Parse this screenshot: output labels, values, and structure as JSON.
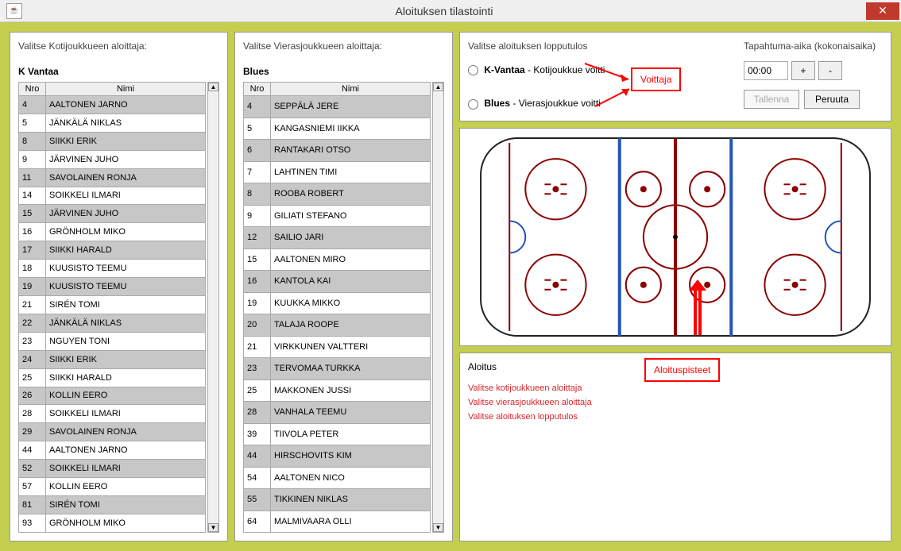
{
  "window": {
    "title": "Aloituksen tilastointi"
  },
  "home": {
    "label": "Valitse Kotijoukkueen aloittaja:",
    "team": "K Vantaa",
    "headers": {
      "nro": "Nro",
      "nimi": "Nimi"
    },
    "players": [
      {
        "nro": "4",
        "nimi": "AALTONEN JARNO"
      },
      {
        "nro": "5",
        "nimi": "JÄNKÄLÄ NIKLAS"
      },
      {
        "nro": "8",
        "nimi": "SIIKKI ERIK"
      },
      {
        "nro": "9",
        "nimi": "JÄRVINEN JUHO"
      },
      {
        "nro": "11",
        "nimi": "SAVOLAINEN RONJA"
      },
      {
        "nro": "14",
        "nimi": "SOIKKELI ILMARI"
      },
      {
        "nro": "15",
        "nimi": "JÄRVINEN JUHO"
      },
      {
        "nro": "16",
        "nimi": "GRÖNHOLM MIKO"
      },
      {
        "nro": "17",
        "nimi": "SIIKKI HARALD"
      },
      {
        "nro": "18",
        "nimi": "KUUSISTO TEEMU"
      },
      {
        "nro": "19",
        "nimi": "KUUSISTO TEEMU"
      },
      {
        "nro": "21",
        "nimi": "SIRÉN TOMI"
      },
      {
        "nro": "22",
        "nimi": "JÄNKÄLÄ NIKLAS"
      },
      {
        "nro": "23",
        "nimi": "NGUYEN TONI"
      },
      {
        "nro": "24",
        "nimi": "SIIKKI ERIK"
      },
      {
        "nro": "25",
        "nimi": "SIIKKI HARALD"
      },
      {
        "nro": "26",
        "nimi": "KOLLIN EERO"
      },
      {
        "nro": "28",
        "nimi": "SOIKKELI ILMARI"
      },
      {
        "nro": "29",
        "nimi": "SAVOLAINEN RONJA"
      },
      {
        "nro": "44",
        "nimi": "AALTONEN JARNO"
      },
      {
        "nro": "52",
        "nimi": "SOIKKELI ILMARI"
      },
      {
        "nro": "57",
        "nimi": "KOLLIN EERO"
      },
      {
        "nro": "81",
        "nimi": "SIRÉN TOMI"
      },
      {
        "nro": "93",
        "nimi": "GRÖNHOLM MIKO"
      }
    ]
  },
  "away": {
    "label": "Valitse Vierasjoukkueen aloittaja:",
    "team": "Blues",
    "headers": {
      "nro": "Nro",
      "nimi": "Nimi"
    },
    "players": [
      {
        "nro": "4",
        "nimi": "SEPPÄLÄ JERE"
      },
      {
        "nro": "5",
        "nimi": "KANGASNIEMI IIKKA"
      },
      {
        "nro": "6",
        "nimi": "RANTAKARI OTSO"
      },
      {
        "nro": "7",
        "nimi": "LAHTINEN TIMI"
      },
      {
        "nro": "8",
        "nimi": "ROOBA ROBERT"
      },
      {
        "nro": "9",
        "nimi": "GILIATI STEFANO"
      },
      {
        "nro": "12",
        "nimi": "SAILIO JARI"
      },
      {
        "nro": "15",
        "nimi": "AALTONEN MIRO"
      },
      {
        "nro": "16",
        "nimi": "KANTOLA KAI"
      },
      {
        "nro": "19",
        "nimi": "KUUKKA MIKKO"
      },
      {
        "nro": "20",
        "nimi": "TALAJA ROOPE"
      },
      {
        "nro": "21",
        "nimi": "VIRKKUNEN VALTTERI"
      },
      {
        "nro": "23",
        "nimi": "TERVOMAA TURKKA"
      },
      {
        "nro": "25",
        "nimi": "MAKKONEN JUSSI"
      },
      {
        "nro": "28",
        "nimi": "VANHALA TEEMU"
      },
      {
        "nro": "39",
        "nimi": "TIIVOLA PETER"
      },
      {
        "nro": "44",
        "nimi": "HIRSCHOVITS KIM"
      },
      {
        "nro": "54",
        "nimi": "AALTONEN NICO"
      },
      {
        "nro": "55",
        "nimi": "TIKKINEN NIKLAS"
      },
      {
        "nro": "64",
        "nimi": "MALMIVAARA OLLI"
      }
    ]
  },
  "result": {
    "header": "Valitse aloituksen lopputulos",
    "opt1_team": "K-Vantaa",
    "opt1_desc": " -  Kotijoukkue voitti",
    "opt2_team": "Blues",
    "opt2_desc": " -  Vierasjoukkue voitti"
  },
  "time": {
    "header": "Tapahtuma-aika (kokonaisaika)",
    "value": "00:00",
    "plus": "+",
    "minus": "-",
    "save": "Tallenna",
    "cancel": "Peruuta"
  },
  "status": {
    "header": "Aloitus",
    "msg1": "Valitse kotijoukkueen aloittaja",
    "msg2": "Valitse vierasjoukkueen aloittaja",
    "msg3": "Valitse aloituksen lopputulos"
  },
  "annotations": {
    "winner": "Voittaja",
    "faceoff": "Aloituspisteet"
  }
}
